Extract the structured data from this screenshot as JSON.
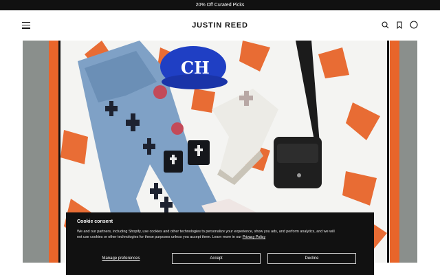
{
  "announcement": {
    "text": "20% Off Curated Picks"
  },
  "header": {
    "logo": "JUSTIN REED",
    "icons": [
      "menu-icon",
      "search-icon",
      "bookmark-icon",
      "account-icon"
    ]
  },
  "hero": {
    "image": "product-flatlay-photo"
  },
  "cookie_banner": {
    "title": "Cookie consent",
    "body_line1": "We and our partners, including Shopify, use cookies and other technologies to personalize your experience, show you ads, and perform analytics, and we will",
    "body_line2": "not use cookies or other technologies for these purposes unless you accept them. Learn more in our ",
    "privacy_link": "Privacy Policy",
    "manage_label": "Manage preferences",
    "accept_label": "Accept",
    "decline_label": "Decline"
  },
  "colors": {
    "topbar": "#111111",
    "banner_bg": "#111111",
    "scarf_orange": "#e8652a",
    "hat_blue": "#1f3fc4"
  }
}
